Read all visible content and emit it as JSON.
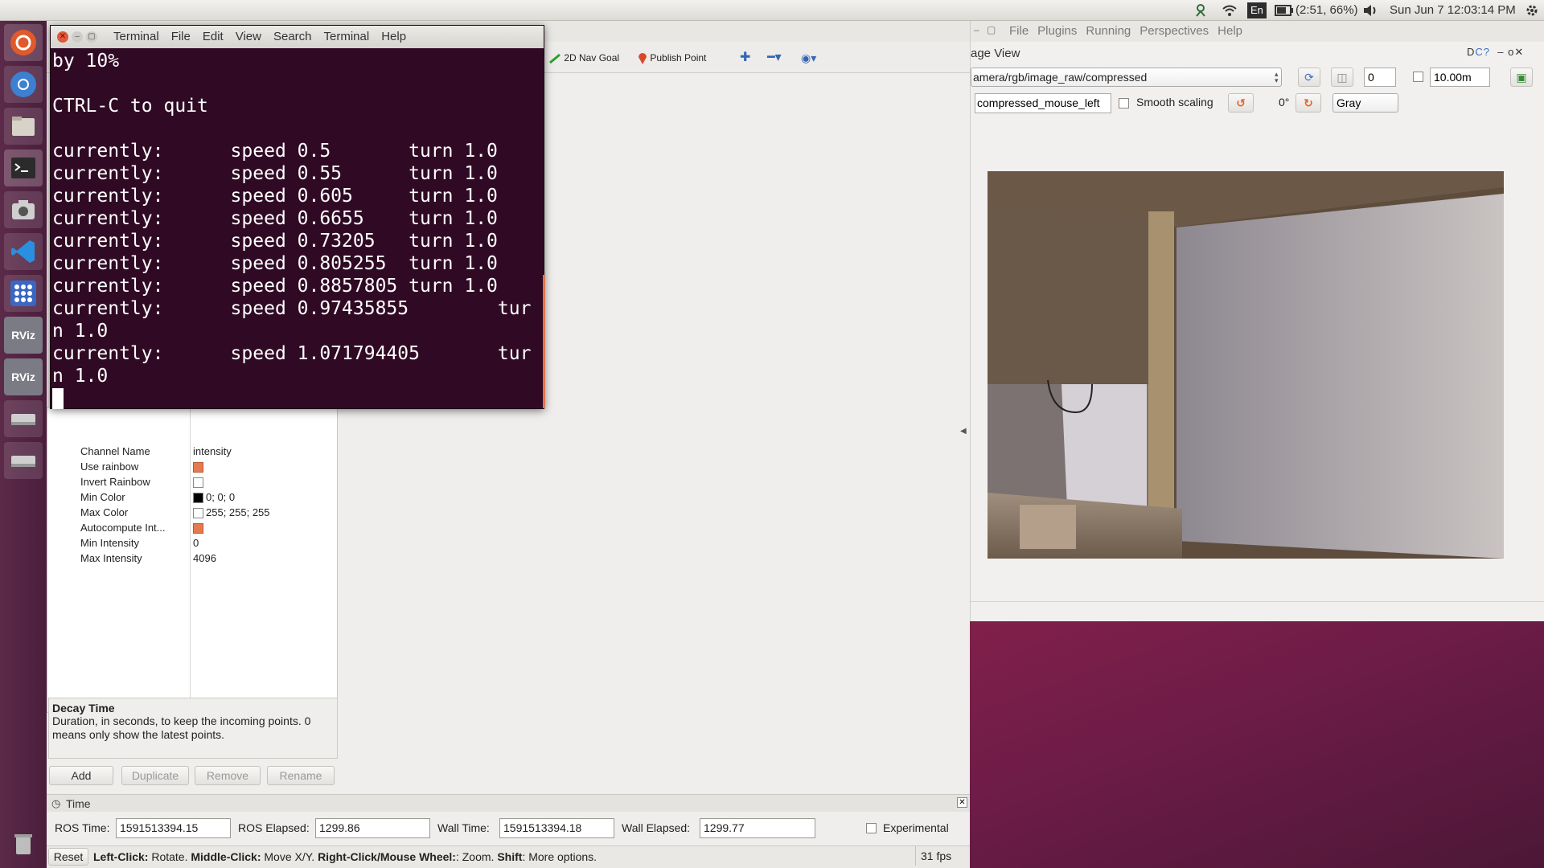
{
  "topbar": {
    "keyboard": "En",
    "battery": "(2:51, 66%)",
    "datetime": "Sun Jun  7 12:03:14 PM"
  },
  "launcher": {
    "items": [
      "ubuntu-dash",
      "chromium",
      "files",
      "terminal",
      "screenshot",
      "vscode",
      "apps",
      "RViz",
      "RViz",
      "drive",
      "drive",
      "trash"
    ],
    "rviz_label": "RViz"
  },
  "terminal": {
    "menu": [
      "Terminal",
      "File",
      "Edit",
      "View",
      "Search",
      "Terminal",
      "Help"
    ],
    "lines": [
      "by 10%",
      "",
      "CTRL-C to quit",
      "",
      "currently:      speed 0.5       turn 1.0",
      "currently:      speed 0.55      turn 1.0",
      "currently:      speed 0.605     turn 1.0",
      "currently:      speed 0.6655    turn 1.0",
      "currently:      speed 0.73205   turn 1.0",
      "currently:      speed 0.805255  turn 1.0",
      "currently:      speed 0.8857805 turn 1.0",
      "currently:      speed 0.97435855        tur",
      "n 1.0",
      "currently:      speed 1.071794405       tur",
      "n 1.0"
    ]
  },
  "rviz": {
    "tools": {
      "nav_goal": "2D Nav Goal",
      "publish_point": "Publish Point"
    },
    "properties": [
      {
        "key": "Channel Name",
        "value": "intensity",
        "kind": "text"
      },
      {
        "key": "Use rainbow",
        "value": "",
        "kind": "check-on"
      },
      {
        "key": "Invert Rainbow",
        "value": "",
        "kind": "check-off"
      },
      {
        "key": "Min Color",
        "value": "0; 0; 0",
        "kind": "color-black"
      },
      {
        "key": "Max Color",
        "value": "255; 255; 255",
        "kind": "color-white"
      },
      {
        "key": "Autocompute Int...",
        "value": "",
        "kind": "check-on"
      },
      {
        "key": "Min Intensity",
        "value": "0",
        "kind": "text"
      },
      {
        "key": "Max Intensity",
        "value": "4096",
        "kind": "text"
      }
    ],
    "help_title": "Decay Time",
    "help_text": "Duration, in seconds, to keep the incoming points. 0 means only show the latest points.",
    "buttons": {
      "add": "Add",
      "duplicate": "Duplicate",
      "remove": "Remove",
      "rename": "Rename"
    },
    "time_panel": {
      "title": "Time",
      "ros_time_label": "ROS Time:",
      "ros_time": "1591513394.15",
      "ros_elapsed_label": "ROS Elapsed:",
      "ros_elapsed": "1299.86",
      "wall_time_label": "Wall Time:",
      "wall_time": "1591513394.18",
      "wall_elapsed_label": "Wall Elapsed:",
      "wall_elapsed": "1299.77",
      "experimental": "Experimental"
    },
    "status": {
      "reset": "Reset",
      "hint_b1": "Left-Click:",
      "hint_t1": " Rotate. ",
      "hint_b2": "Middle-Click:",
      "hint_t2": " Move X/Y. ",
      "hint_b3": "Right-Click/Mouse Wheel:",
      "hint_t3": ": Zoom. ",
      "hint_b4": "Shift",
      "hint_t4": ": More options.",
      "fps": "31 fps"
    }
  },
  "image_view": {
    "menu": [
      "File",
      "Plugins",
      "Running",
      "Perspectives",
      "Help"
    ],
    "title": "age View",
    "topic": "amera/rgb/image_raw/compressed",
    "spin_value": "0",
    "distance": "10.00m",
    "mouse_topic": "compressed_mouse_left",
    "smooth_scaling": "Smooth scaling",
    "rotation": "0°",
    "colormap": "Gray"
  }
}
